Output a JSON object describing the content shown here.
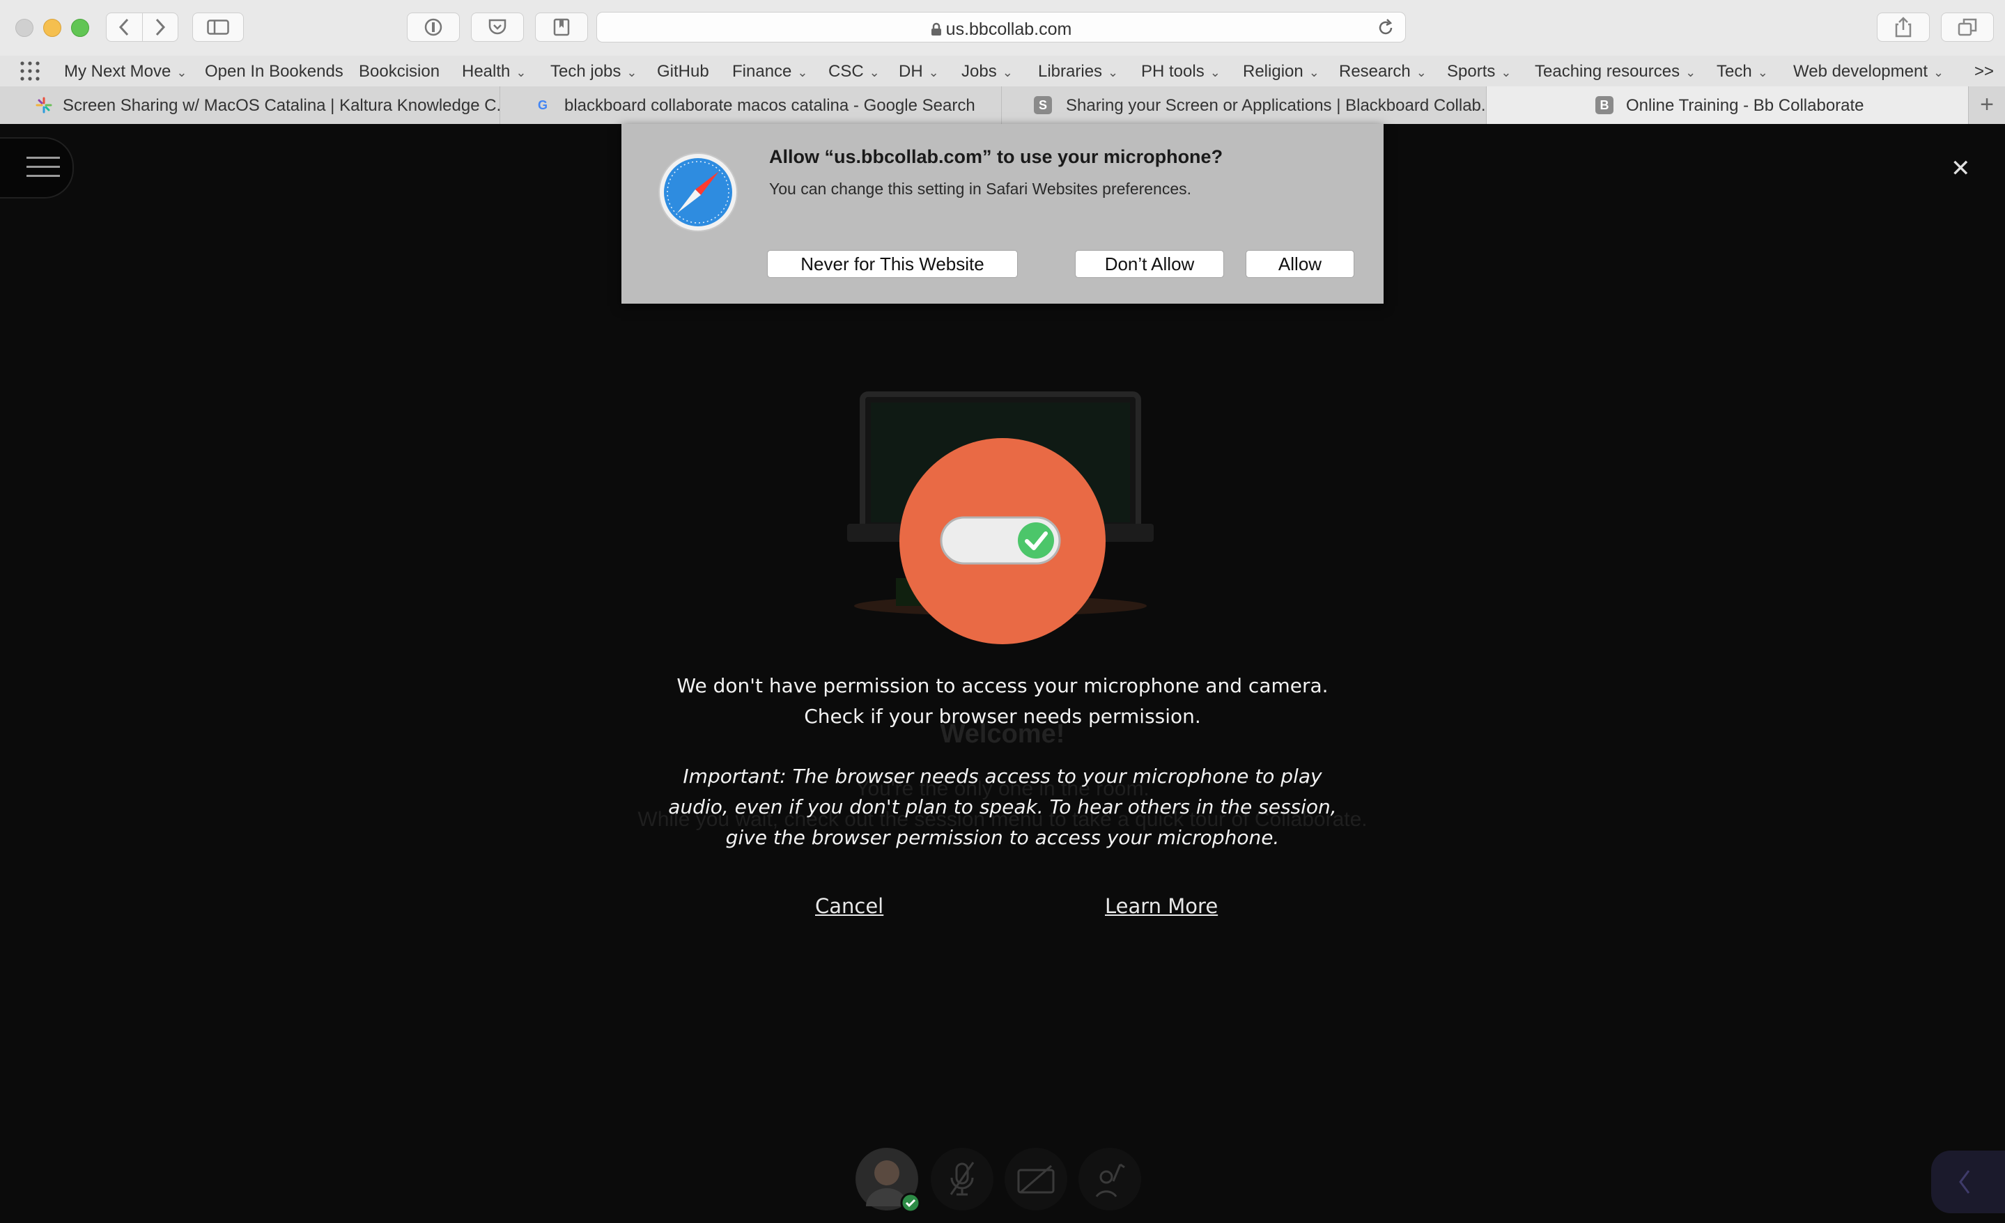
{
  "browser": {
    "url": "us.bbcollab.com",
    "bookmarks": [
      {
        "label": "My Next Move",
        "dropdown": true
      },
      {
        "label": "Open In Bookends",
        "dropdown": false
      },
      {
        "label": "Bookcision",
        "dropdown": false
      },
      {
        "label": "Health",
        "dropdown": true
      },
      {
        "label": "Tech jobs",
        "dropdown": true
      },
      {
        "label": "GitHub",
        "dropdown": false
      },
      {
        "label": "Finance",
        "dropdown": true
      },
      {
        "label": "CSC",
        "dropdown": true
      },
      {
        "label": "DH",
        "dropdown": true
      },
      {
        "label": "Jobs",
        "dropdown": true
      },
      {
        "label": "Libraries",
        "dropdown": true
      },
      {
        "label": "PH tools",
        "dropdown": true
      },
      {
        "label": "Religion",
        "dropdown": true
      },
      {
        "label": "Research",
        "dropdown": true
      },
      {
        "label": "Sports",
        "dropdown": true
      },
      {
        "label": "Teaching resources",
        "dropdown": true
      },
      {
        "label": "Tech",
        "dropdown": true
      },
      {
        "label": "Web development",
        "dropdown": true
      }
    ],
    "bookmarks_overflow": ">>",
    "tabs": [
      {
        "label": "Screen Sharing w/ MacOS Catalina | Kaltura Knowledge C...",
        "icon": "kaltura-icon",
        "active": false
      },
      {
        "label": "blackboard collaborate macos catalina - Google Search",
        "icon": "google-icon",
        "active": false
      },
      {
        "label": "Sharing your Screen or Applications | Blackboard Collab...",
        "icon": "s-favicon",
        "active": false
      },
      {
        "label": "Online Training - Bb Collaborate",
        "icon": "b-favicon",
        "active": true
      }
    ],
    "tab_favicons": {
      "s": "S",
      "b": "B",
      "g": "G"
    },
    "new_tab": "+"
  },
  "dialog": {
    "title": "Allow “us.bbcollab.com” to use your microphone?",
    "subtitle": "You can change this setting in Safari Websites preferences.",
    "never_button": "Never for This Website",
    "dont_allow_button": "Don’t Allow",
    "allow_button": "Allow",
    "icon": "safari-compass-icon"
  },
  "session": {
    "close_glyph": "✕",
    "background_welcome": "Welcome!",
    "background_line1": "You're the only one in the room.",
    "background_line2": "While you wait, check out the session menu to take a quick tour of Collaborate.",
    "permission_line1": "We don't have permission to access your microphone and camera.",
    "permission_line2": "Check if your browser needs permission.",
    "important_line1": "Important: The browser needs access to your microphone to play",
    "important_line2": "audio, even if you don't plan to speak. To hear others in the session,",
    "important_line3": "give the browser permission to access your microphone.",
    "cancel_link": "Cancel",
    "learn_more_link": "Learn More",
    "accent_color": "#e96a45",
    "toggle_check_color": "#4cc66a"
  },
  "controls": [
    "avatar",
    "microphone-muted-icon",
    "camera-off-icon",
    "raise-hand-icon"
  ]
}
